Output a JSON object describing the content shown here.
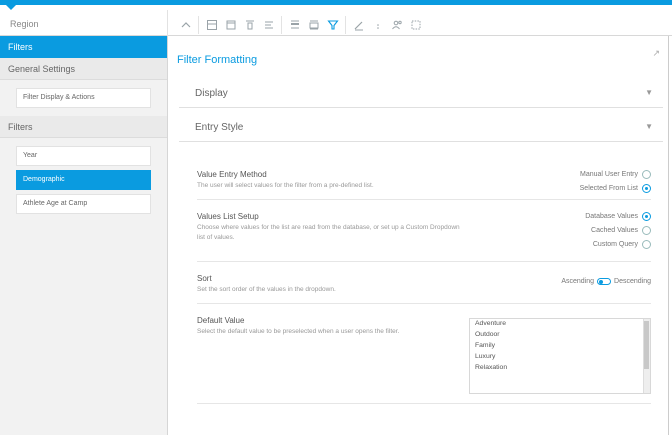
{
  "search": {
    "value": "Region"
  },
  "toolbar": {
    "icons": [
      "chevron-up-icon",
      "layout-icon",
      "box-icon",
      "align-icon",
      "list-icon",
      "columns-icon",
      "table-icon",
      "filter-icon",
      "pen-icon",
      "dots-icon",
      "people-icon",
      "dashed-box-icon"
    ]
  },
  "sidebar": {
    "filters_header": "Filters",
    "general_header": "General Settings",
    "general_items": [
      {
        "label": "Filter Display & Actions"
      }
    ],
    "filters_section_header": "Filters",
    "filter_items": [
      {
        "label": "Year"
      },
      {
        "label": "Demographic"
      },
      {
        "label": "Athlete Age at Camp"
      }
    ]
  },
  "main": {
    "title": "Filter Formatting",
    "sections": [
      {
        "label": "Display"
      },
      {
        "label": "Entry Style"
      }
    ],
    "options": [
      {
        "title": "Value Entry Method",
        "desc": "The user will select values for the filter from a pre-defined list.",
        "choices": [
          {
            "label": "Manual User Entry",
            "on": false
          },
          {
            "label": "Selected From List",
            "on": true
          }
        ]
      },
      {
        "title": "Values List Setup",
        "desc": "Choose where values for the list are read from the database, or set up a Custom Dropdown list of values.",
        "choices": [
          {
            "label": "Database Values",
            "on": true
          },
          {
            "label": "Cached Values",
            "on": false
          },
          {
            "label": "Custom Query",
            "on": false
          }
        ]
      },
      {
        "title": "Sort",
        "desc": "Set the sort order of the values in the dropdown.",
        "toggle_left": "Ascending",
        "toggle_right": "Descending"
      },
      {
        "title": "Default Value",
        "desc": "Select the default value to be preselected when a user opens the filter.",
        "list": [
          "Adventure",
          "Outdoor",
          "Family",
          "Luxury",
          "Relaxation"
        ]
      }
    ]
  },
  "colors": {
    "accent": "#0a9be0"
  }
}
